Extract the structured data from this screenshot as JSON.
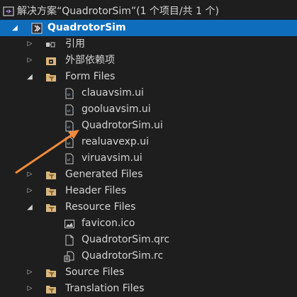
{
  "solution": {
    "label": "解决方案“QuadrotorSim”(1 个项目/共 1 个)",
    "icon": "solution-icon"
  },
  "project": {
    "label": "QuadrotorSim",
    "icon": "qt-project-icon",
    "selected_color": "#0e6ebd"
  },
  "tree": {
    "references": "引用",
    "external_deps": "外部依赖项",
    "form_files": "Form Files",
    "form_items": [
      "clauavsim.ui",
      "gooluavsim.ui",
      "QuadrotorSim.ui",
      "realuavexp.ui",
      "viruavsim.ui"
    ],
    "generated_files": "Generated Files",
    "header_files": "Header Files",
    "resource_files": "Resource Files",
    "resource_items": [
      "favicon.ico",
      "QuadrotorSim.qrc",
      "QuadrotorSim.rc"
    ],
    "source_files": "Source Files",
    "translation_files": "Translation Files"
  },
  "annotation": {
    "type": "arrow",
    "color": "#f08a3c",
    "points_to": "QuadrotorSim.ui"
  }
}
